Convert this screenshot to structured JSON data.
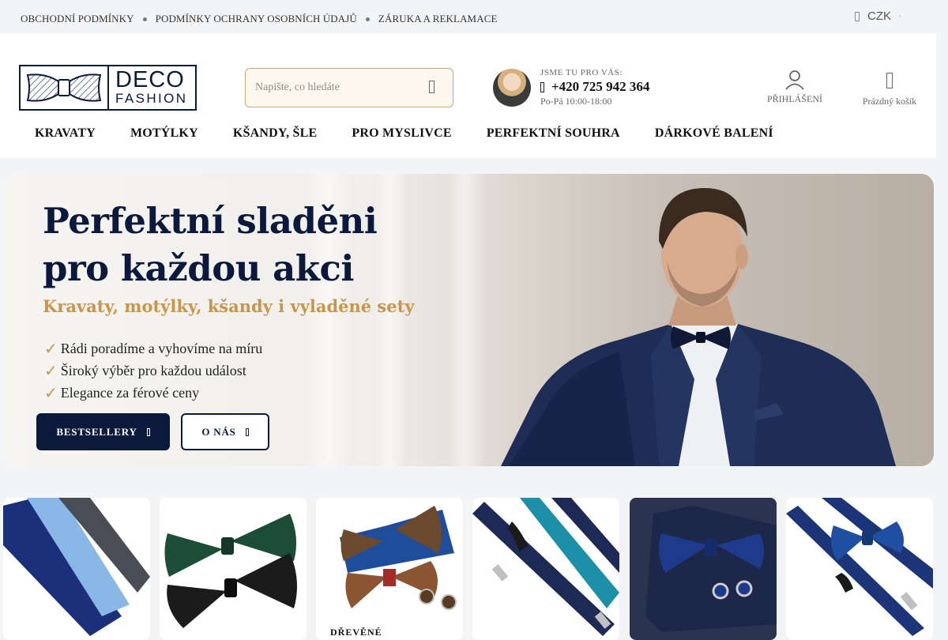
{
  "topbar": {
    "links": [
      "OBCHODNÍ PODMÍNKY",
      "PODMÍNKY OCHRANY OSOBNÍCH ÚDAJŮ",
      "ZÁRUKA A REKLAMACE"
    ],
    "currency": "CZK"
  },
  "logo": {
    "line1": "DECO",
    "line2": "FASHION"
  },
  "search": {
    "placeholder": "Napište, co hledáte"
  },
  "contact": {
    "label": "JSME TU PRO VÁS:",
    "phone": "+420 725 942 364",
    "hours": "Po-Pá 10:00-18:00"
  },
  "account": {
    "login_label": "PŘIHLÁŠENÍ",
    "cart_label": "Prázdný košík"
  },
  "nav": [
    "KRAVATY",
    "MOTÝLKY",
    "KŠANDY, ŠLE",
    "PRO MYSLIVCE",
    "PERFEKTNÍ SOUHRA",
    "DÁRKOVÉ BALENÍ"
  ],
  "hero": {
    "title_line1": "Perfektní sladěni",
    "title_line2": "pro každou akci",
    "subtitle": "Kravaty, motýlky, kšandy i vyladěné sety",
    "bullets": [
      "Rádi poradíme a vyhovíme na míru",
      "Široký výběr pro každou událost",
      "Elegance za férové ceny"
    ],
    "btn_primary": "BESTSELLERY",
    "btn_secondary": "O NÁS"
  },
  "categories": [
    {
      "image": "neckties"
    },
    {
      "image": "bow-ties"
    },
    {
      "image": "wooden-bow-tie",
      "label": "DŘEVĚNÉ"
    },
    {
      "image": "suspenders"
    },
    {
      "image": "gift-box-set"
    },
    {
      "image": "bow-tie-suspenders-set"
    }
  ],
  "colors": {
    "navy": "#0b1a3c",
    "gold": "#c8954a",
    "background": "#f3f4f6"
  }
}
